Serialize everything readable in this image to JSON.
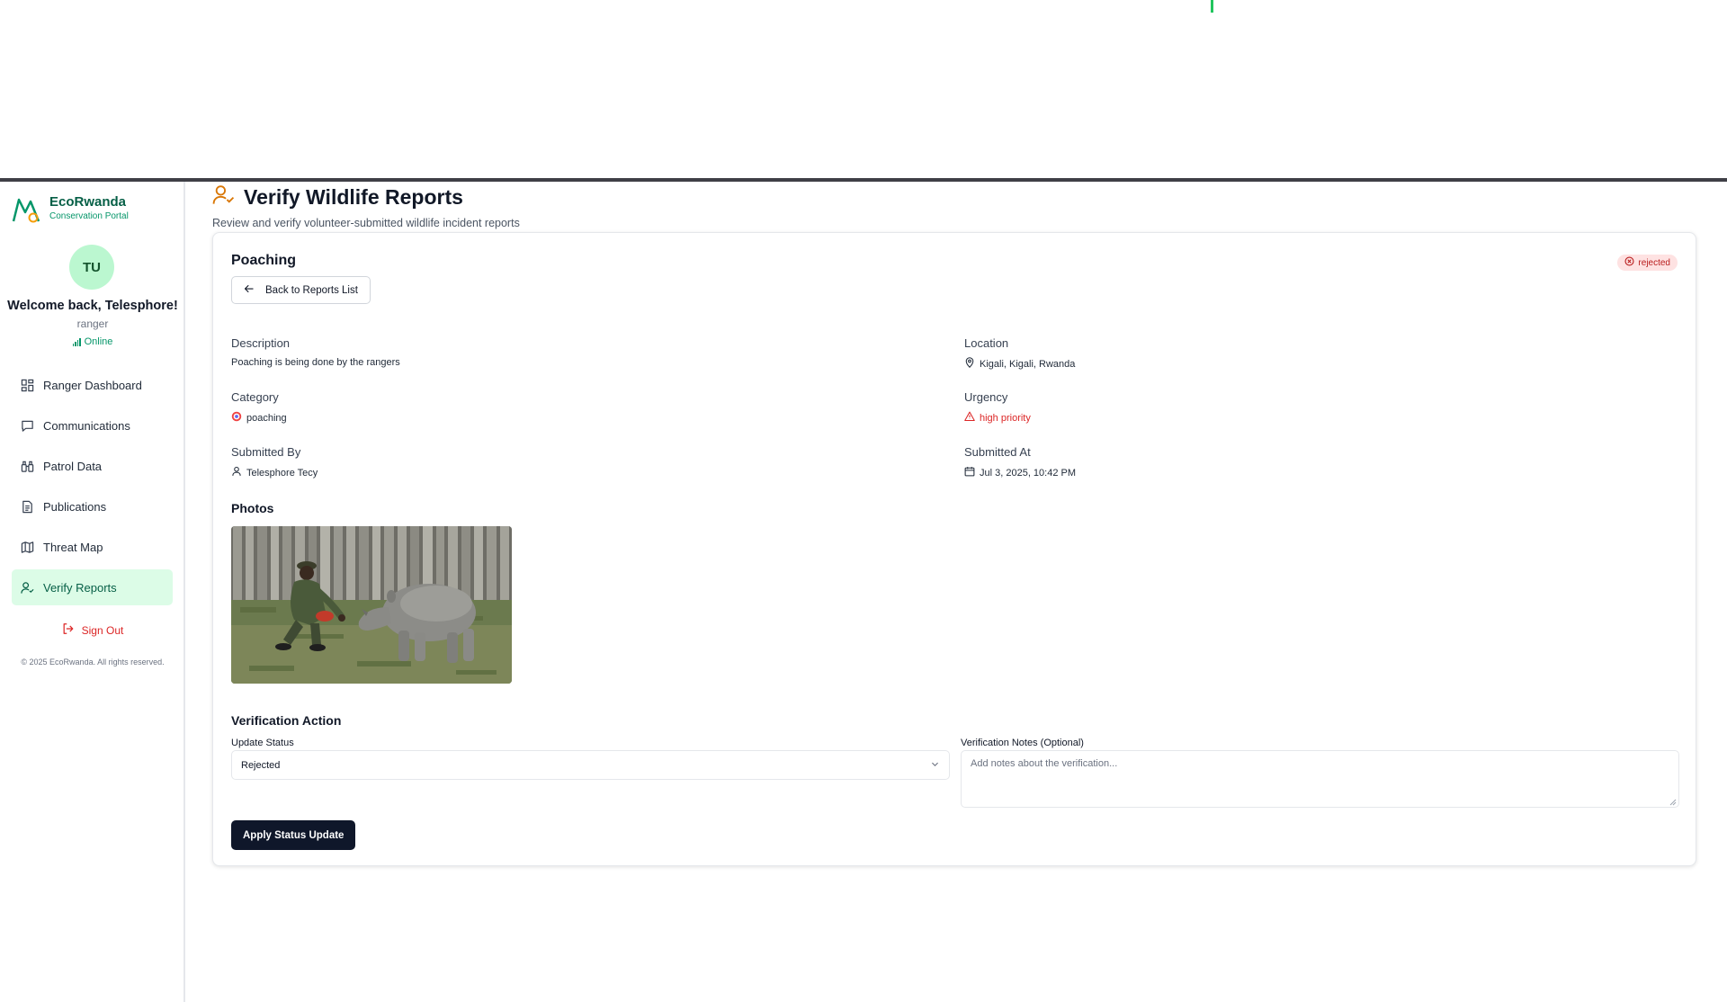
{
  "brand": {
    "name": "EcoRwanda",
    "subtitle": "Conservation Portal"
  },
  "user": {
    "initials": "TU",
    "welcome": "Welcome back, Telesphore!",
    "role": "ranger",
    "status": "Online"
  },
  "sidebar": {
    "items": [
      {
        "label": "Ranger Dashboard",
        "icon": "dashboard-grid-icon",
        "active": false
      },
      {
        "label": "Communications",
        "icon": "message-square-icon",
        "active": false
      },
      {
        "label": "Patrol Data",
        "icon": "binoculars-icon",
        "active": false
      },
      {
        "label": "Publications",
        "icon": "file-text-icon",
        "active": false
      },
      {
        "label": "Threat Map",
        "icon": "map-icon",
        "active": false
      },
      {
        "label": "Verify Reports",
        "icon": "user-check-icon",
        "active": true
      }
    ],
    "sign_out": "Sign Out",
    "copyright": "© 2025 EcoRwanda. All rights reserved."
  },
  "page": {
    "title": "Verify Wildlife Reports",
    "subtitle": "Review and verify volunteer-submitted wildlife incident reports"
  },
  "report": {
    "title": "Poaching",
    "status": "rejected",
    "back_label": "Back to Reports List",
    "description_label": "Description",
    "description": "Poaching is being done by the rangers",
    "location_label": "Location",
    "location": "Kigali, Kigali, Rwanda",
    "category_label": "Category",
    "category": "poaching",
    "urgency_label": "Urgency",
    "urgency": "high priority",
    "submitted_by_label": "Submitted By",
    "submitted_by": "Telesphore Tecy",
    "submitted_at_label": "Submitted At",
    "submitted_at": "Jul 3, 2025, 10:42 PM",
    "photos_label": "Photos"
  },
  "verification": {
    "section_title": "Verification Action",
    "status_label": "Update Status",
    "status_value": "Rejected",
    "notes_label": "Verification Notes (Optional)",
    "notes_placeholder": "Add notes about the verification...",
    "apply_label": "Apply Status Update"
  },
  "colors": {
    "brand_green": "#065f46",
    "active_nav_bg": "#dcfce7",
    "danger": "#dc2626",
    "primary_button": "#0f172a",
    "accent_orange": "#d97706"
  }
}
